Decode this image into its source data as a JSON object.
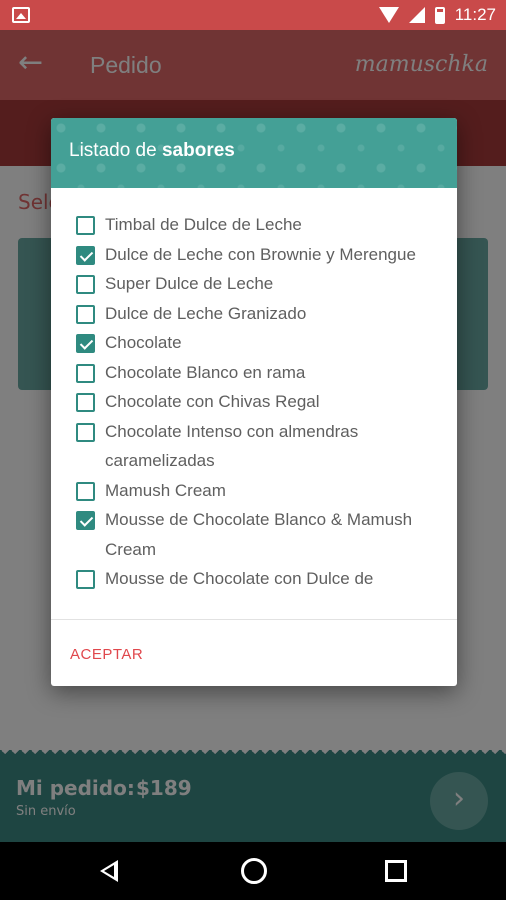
{
  "status_bar": {
    "time": "11:27"
  },
  "app_bar": {
    "back_icon": "arrow-left-icon",
    "title": "Pedido",
    "brand": "mamuschka"
  },
  "background": {
    "select_text": "Sele"
  },
  "order_bar": {
    "label": "Mi pedido:",
    "price": "$189",
    "shipping": "Sin envío",
    "next_icon": "chevron-right-icon"
  },
  "dialog": {
    "title_prefix": "Listado de",
    "title_bold": "sabores",
    "items": [
      {
        "label": "Timbal de Dulce de Leche",
        "checked": false
      },
      {
        "label": "Dulce de Leche con Brownie y Merengue",
        "checked": true
      },
      {
        "label": "Super Dulce de Leche",
        "checked": false
      },
      {
        "label": "Dulce de Leche Granizado",
        "checked": false
      },
      {
        "label": "Chocolate",
        "checked": true
      },
      {
        "label": "Chocolate Blanco en rama",
        "checked": false
      },
      {
        "label": "Chocolate con Chivas Regal",
        "checked": false
      },
      {
        "label": "Chocolate Intenso con almendras caramelizadas",
        "checked": false
      },
      {
        "label": "Mamush Cream",
        "checked": false
      },
      {
        "label": "Mousse de Chocolate Blanco & Mamush Cream",
        "checked": true
      },
      {
        "label": "Mousse de Chocolate con Dulce de",
        "checked": false
      }
    ],
    "accept_label": "ACEPTAR"
  },
  "colors": {
    "primary": "#e16868",
    "accent_teal": "#44a096",
    "checkbox": "#2f8a80",
    "action_red": "#e0474c"
  }
}
